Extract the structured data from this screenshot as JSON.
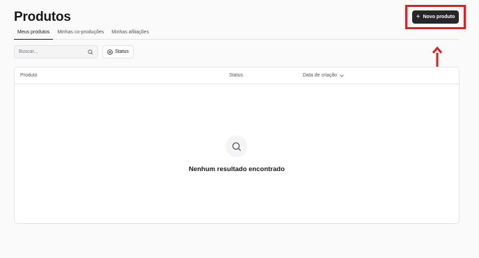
{
  "header": {
    "title": "Produtos",
    "new_button_label": "Novo produto"
  },
  "tabs": [
    {
      "label": "Meus produtos",
      "active": true
    },
    {
      "label": "Minhas co-produções",
      "active": false
    },
    {
      "label": "Minhas afiliações",
      "active": false
    }
  ],
  "filters": {
    "search_placeholder": "Buscar...",
    "status_label": "Status"
  },
  "table": {
    "columns": [
      "Produto",
      "Status",
      "Data de criação"
    ],
    "sorted_column": "Data de criação",
    "empty_message": "Nenhum resultado encontrado"
  },
  "annotation": {
    "color": "#e01e24"
  }
}
